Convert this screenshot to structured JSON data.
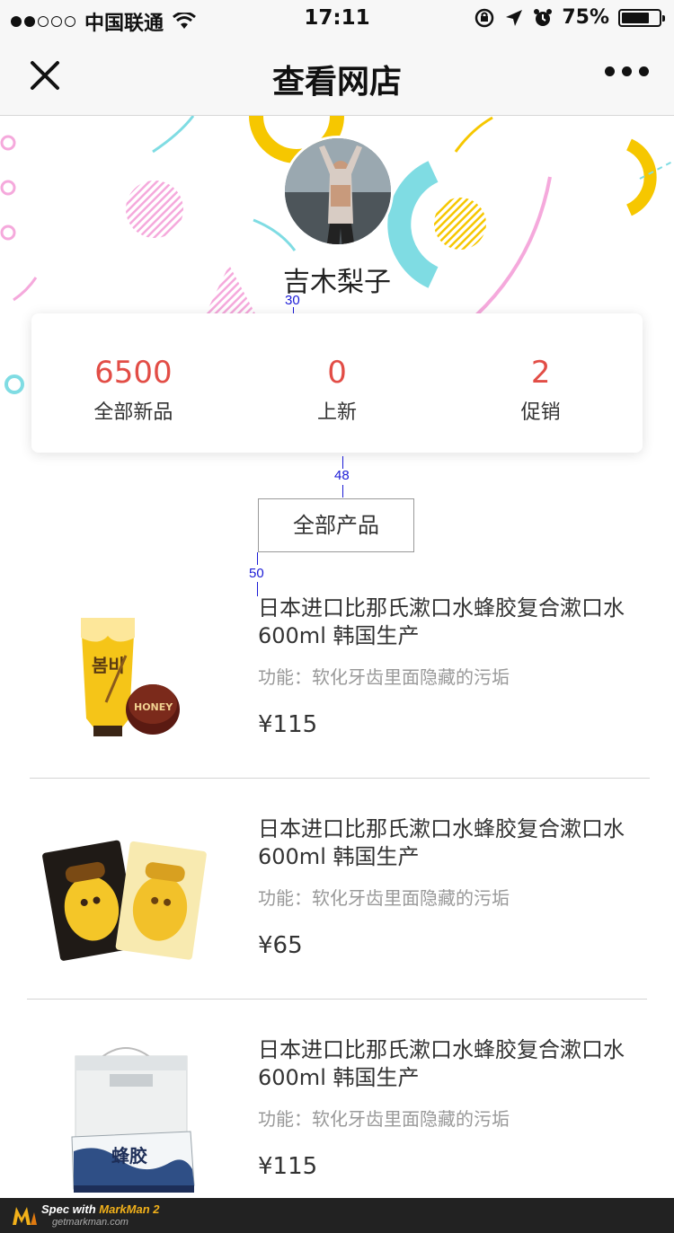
{
  "status_bar": {
    "carrier": "中国联通",
    "time": "17:11",
    "battery": "75%",
    "battery_level": 0.75
  },
  "nav": {
    "title": "查看网店"
  },
  "shop": {
    "name": "吉木梨子"
  },
  "spec_annotations": {
    "gap_name_card": "30",
    "gap_card_tab": "48",
    "gap_tab_list": "50"
  },
  "stats": [
    {
      "value": "6500",
      "label": "全部新品"
    },
    {
      "value": "0",
      "label": "上新"
    },
    {
      "value": "2",
      "label": "促销"
    }
  ],
  "tab": {
    "label": "全部产品"
  },
  "products": [
    {
      "title": "日本进口比那氏漱口水蜂胶复合漱口水600ml 韩国生产",
      "desc": "功能：软化牙齿里面隐藏的污垢",
      "price": "¥115",
      "image_icon": "honey-cream-product-image",
      "image_text": "HONEY"
    },
    {
      "title": "日本进口比那氏漱口水蜂胶复合漱口水600ml 韩国生产",
      "desc": "功能：软化牙齿里面隐藏的污垢",
      "price": "¥65",
      "image_icon": "honey-mask-product-image"
    },
    {
      "title": "日本进口比那氏漱口水蜂胶复合漱口水600ml 韩国生产",
      "desc": "功能：软化牙齿里面隐藏的污垢",
      "price": "¥115",
      "image_icon": "propolis-giftbox-product-image"
    }
  ],
  "footer": {
    "spec_with": "Spec with ",
    "brand": "MarkMan 2",
    "site": "getmarkman.com"
  },
  "colors": {
    "accent_red": "#e24d46",
    "deco_yellow": "#f6c700",
    "deco_cyan": "#7fdce3",
    "deco_pink": "#f5a9dc"
  }
}
